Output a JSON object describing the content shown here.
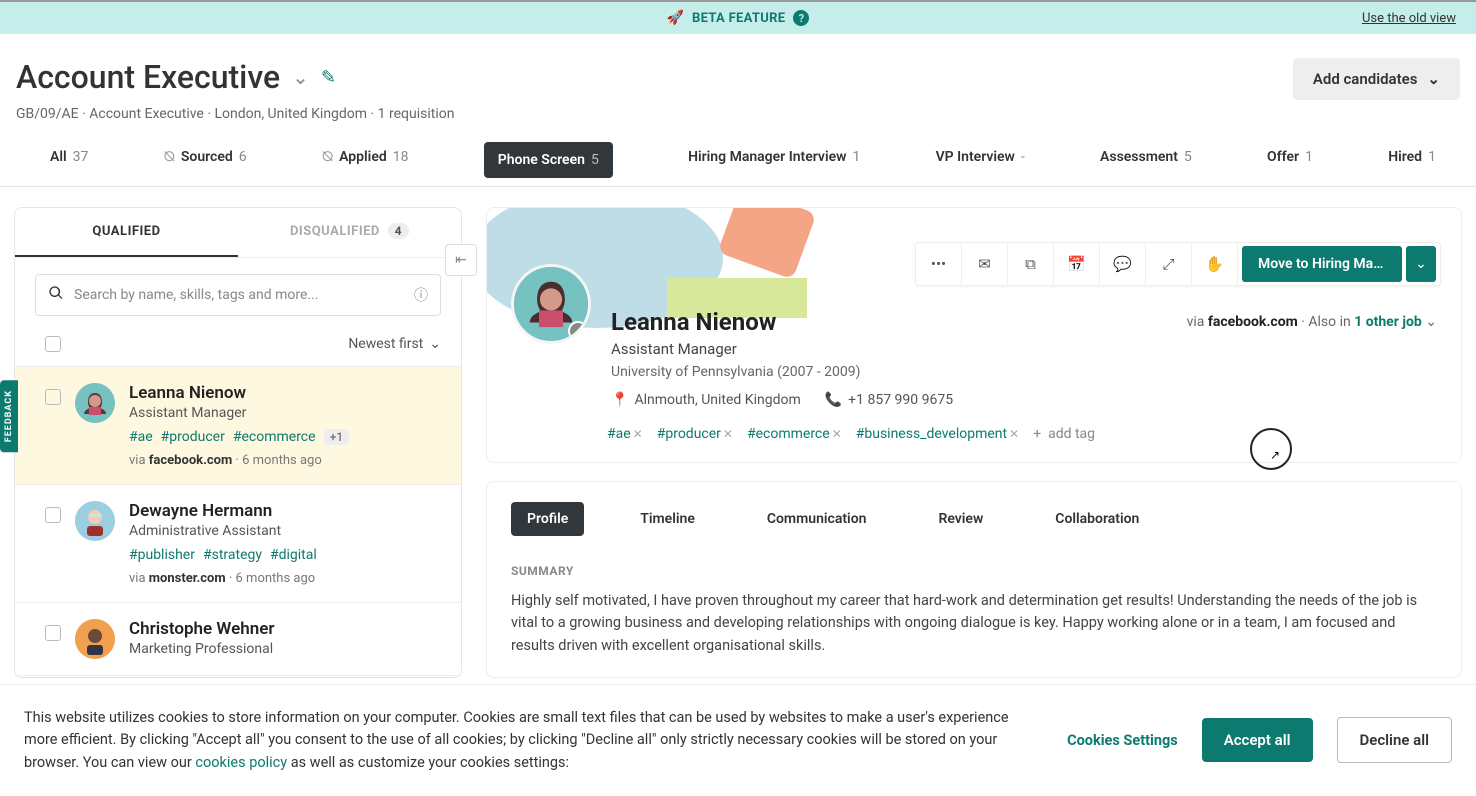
{
  "beta": {
    "label": "BETA FEATURE",
    "old_view": "Use the old view"
  },
  "header": {
    "title": "Account Executive",
    "subtitle": "GB/09/AE · Account Executive · London, United Kingdom · 1 requisition",
    "add_candidates": "Add candidates"
  },
  "stages": [
    {
      "name": "All",
      "count": "37",
      "hidden": false
    },
    {
      "name": "Sourced",
      "count": "6",
      "hidden": true
    },
    {
      "name": "Applied",
      "count": "18",
      "hidden": true
    },
    {
      "name": "Phone Screen",
      "count": "5",
      "hidden": false,
      "active": true
    },
    {
      "name": "Hiring Manager Interview",
      "count": "1",
      "hidden": false
    },
    {
      "name": "VP Interview",
      "count": "-",
      "hidden": false
    },
    {
      "name": "Assessment",
      "count": "5",
      "hidden": false
    },
    {
      "name": "Offer",
      "count": "1",
      "hidden": false
    },
    {
      "name": "Hired",
      "count": "1",
      "hidden": false
    }
  ],
  "qual_tabs": {
    "qualified": "QUALIFIED",
    "disqualified": "DISQUALIFIED",
    "disq_count": "4"
  },
  "search": {
    "placeholder": "Search by name, skills, tags and more..."
  },
  "sort": {
    "label": "Newest first"
  },
  "candidates": [
    {
      "name": "Leanna Nienow",
      "role": "Assistant Manager",
      "tags": [
        "#ae",
        "#producer",
        "#ecommerce"
      ],
      "more_tags": "+1",
      "source": "facebook.com",
      "ago": "6 months ago",
      "avatar_bg": "#76c2c0",
      "selected": true
    },
    {
      "name": "Dewayne Hermann",
      "role": "Administrative Assistant",
      "tags": [
        "#publisher",
        "#strategy",
        "#digital"
      ],
      "source": "monster.com",
      "ago": "6 months ago",
      "avatar_bg": "#9bcfe0"
    },
    {
      "name": "Christophe Wehner",
      "role": "Marketing Professional",
      "tags": [],
      "avatar_bg": "#f0a050"
    }
  ],
  "feedback_tab": "FEEDBACK",
  "detail": {
    "name": "Leanna Nienow",
    "role": "Assistant Manager",
    "education": "University of Pennsylvania (2007 - 2009)",
    "location": "Alnmouth, United Kingdom",
    "phone": "+1 857 990 9675",
    "via_prefix": "via ",
    "via": "facebook.com",
    "also_in_sep": " · Also in ",
    "other_job": "1 other job",
    "tags": [
      "#ae",
      "#producer",
      "#ecommerce",
      "#business_development"
    ],
    "add_tag": "add tag",
    "move_btn": "Move to Hiring Mana..."
  },
  "profile_tabs": [
    "Profile",
    "Timeline",
    "Communication",
    "Review",
    "Collaboration"
  ],
  "summary": {
    "heading": "SUMMARY",
    "text": "Highly self motivated, I have proven throughout my career that hard-work and determination get results! Understanding the needs of the job is vital to a growing business and developing relationships with ongoing dialogue is key. Happy working alone or in a team, I am focused and results driven with excellent organisational skills."
  },
  "cookies": {
    "text_a": "This website utilizes cookies to store information on your computer. Cookies are small text files that can be used by websites to make a user's experience more efficient.  By clicking \"Accept all\" you consent to the use of all cookies; by clicking \"Decline all\" only strictly necessary cookies will be stored on your browser. You can view our ",
    "policy": "cookies policy",
    "text_b": " as well as customize your cookies settings:",
    "settings": "Cookies Settings",
    "accept": "Accept all",
    "decline": "Decline all"
  }
}
